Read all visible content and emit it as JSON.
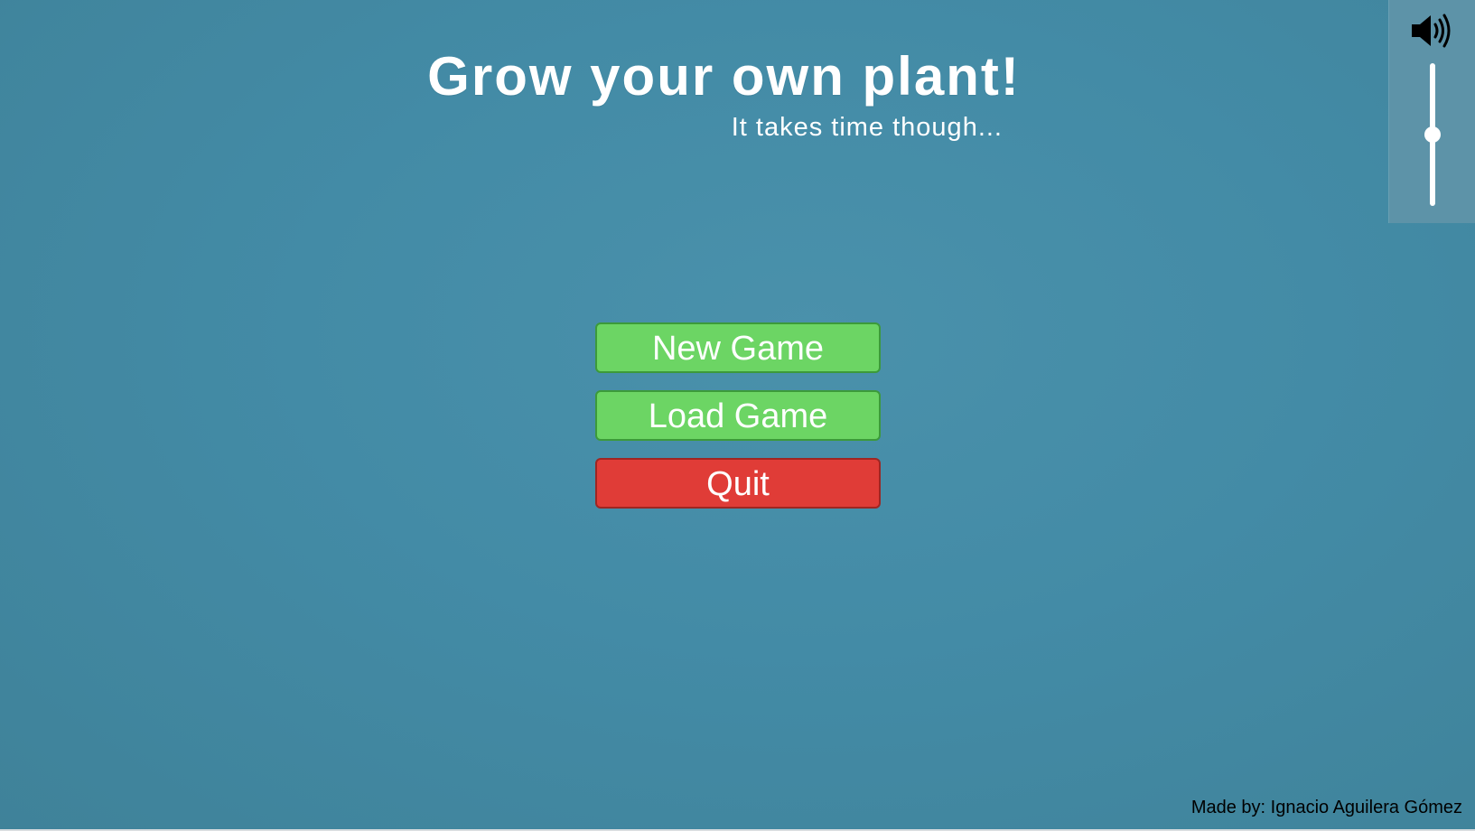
{
  "header": {
    "title": "Grow your own plant!",
    "subtitle": "It takes time though..."
  },
  "menu": {
    "buttons": [
      {
        "label": "New Game",
        "color": "#6cd564"
      },
      {
        "label": "Load Game",
        "color": "#6cd564"
      },
      {
        "label": "Quit",
        "color": "#e03c37"
      }
    ]
  },
  "volume": {
    "icon": "speaker-volume-icon",
    "level": 0.5
  },
  "footer": {
    "credits": "Made by: Ignacio Aguilera Gómez"
  },
  "colors": {
    "background": "#448ca7",
    "button_green": "#6cd564",
    "button_red": "#e03c37"
  }
}
